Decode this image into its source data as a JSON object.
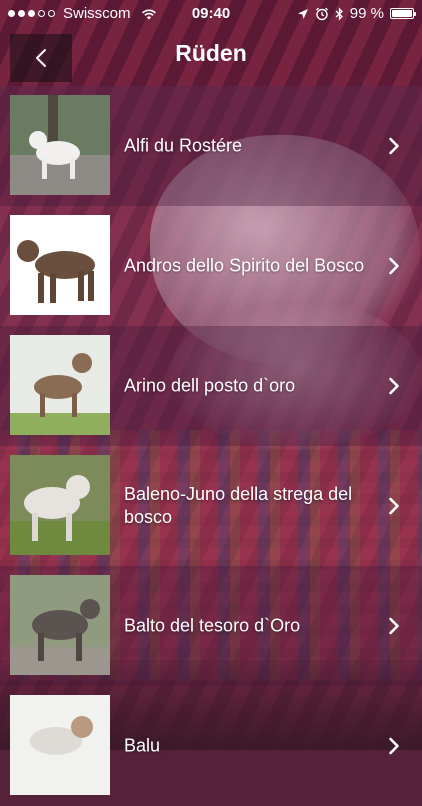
{
  "status_bar": {
    "carrier": "Swisscom",
    "time": "09:40",
    "battery_percent": "99 %",
    "battery_level": 0.99,
    "signal_bars_filled": 3,
    "signal_bars_total": 5
  },
  "nav": {
    "title": "Rüden",
    "back_icon": "chevron-left-icon"
  },
  "dogs": [
    {
      "name": "Alfi du Rostére"
    },
    {
      "name": "Andros dello Spirito del Bosco"
    },
    {
      "name": "Arino dell posto d`oro"
    },
    {
      "name": "Baleno-Juno della strega del bosco"
    },
    {
      "name": "Balto del tesoro d`Oro"
    },
    {
      "name": "Balu"
    }
  ],
  "colors": {
    "accent_text": "#ffffff",
    "row_tint_dark": "#5f284b",
    "row_tint_light": "#964669"
  }
}
